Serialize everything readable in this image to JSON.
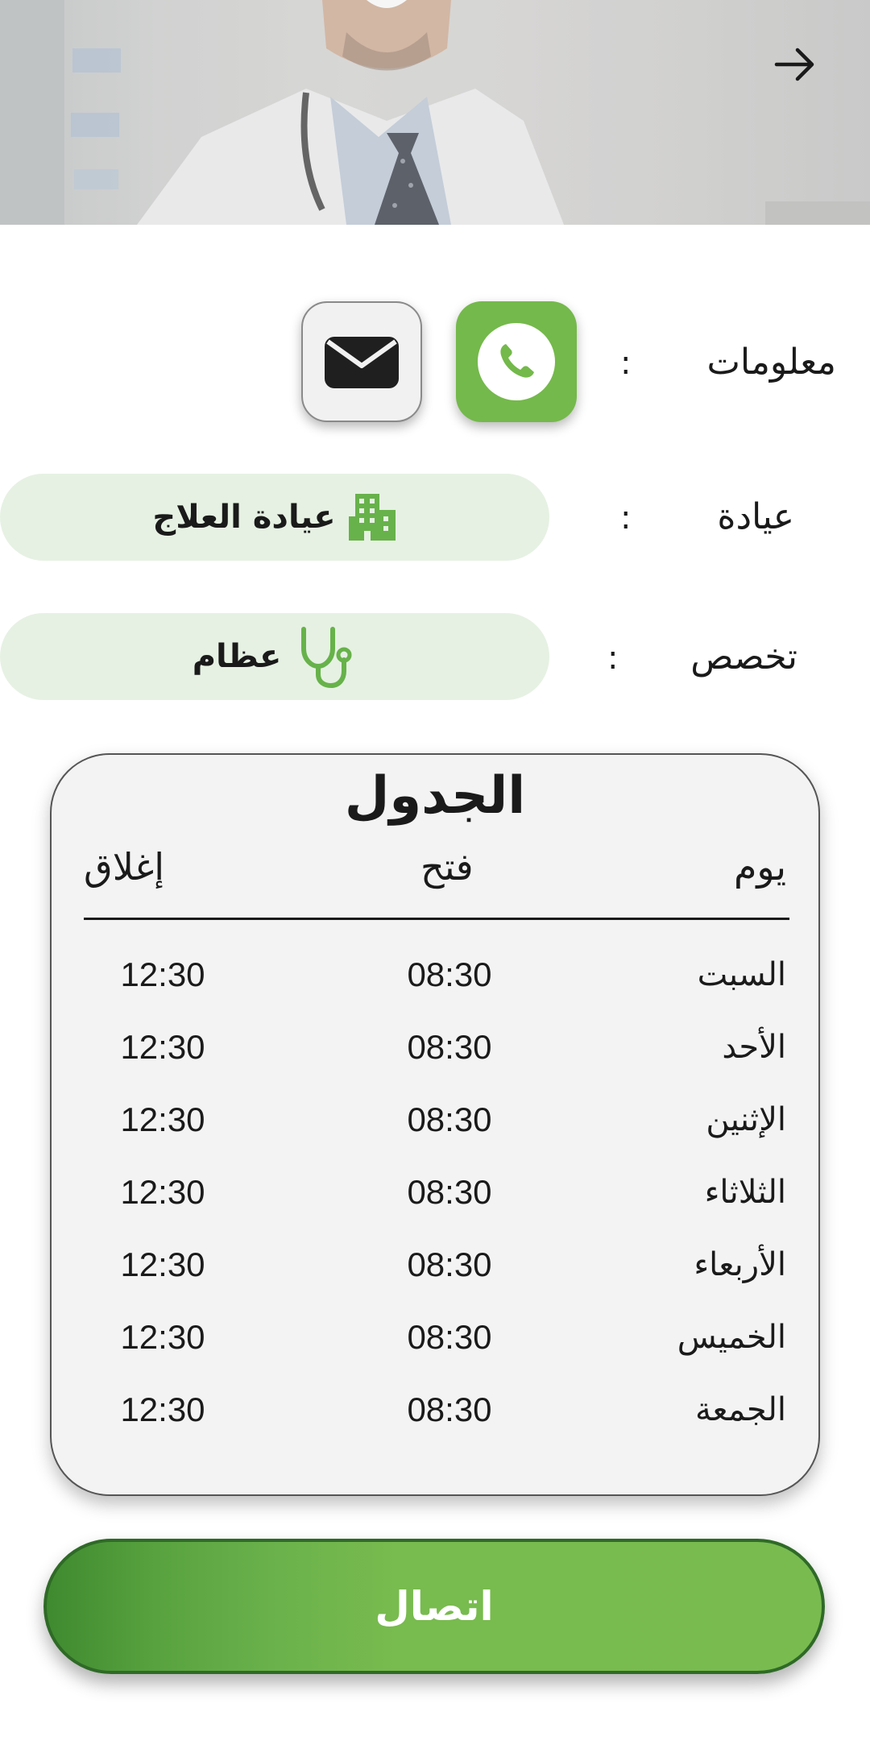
{
  "header": {
    "back_icon": "arrow-right-icon"
  },
  "info": {
    "label": "معلومات",
    "colon": ":",
    "phone_icon": "phone-icon",
    "email_icon": "mail-icon"
  },
  "clinic": {
    "label": "عيادة",
    "colon": ":",
    "value": "عيادة العلاج",
    "icon": "building-icon"
  },
  "specialty": {
    "label": "تخصص",
    "colon": ":",
    "value": "عظام",
    "icon": "stethoscope-icon"
  },
  "schedule": {
    "title": "الجدول",
    "headers": {
      "day": "يوم",
      "open": "فتح",
      "close": "إغلاق"
    },
    "rows": [
      {
        "day": "السبت",
        "open": "08:30",
        "close": "12:30"
      },
      {
        "day": "الأحد",
        "open": "08:30",
        "close": "12:30"
      },
      {
        "day": "الإثنين",
        "open": "08:30",
        "close": "12:30"
      },
      {
        "day": "الثلاثاء",
        "open": "08:30",
        "close": "12:30"
      },
      {
        "day": "الأربعاء",
        "open": "08:30",
        "close": "12:30"
      },
      {
        "day": "الخميس",
        "open": "08:30",
        "close": "12:30"
      },
      {
        "day": "الجمعة",
        "open": "08:30",
        "close": "12:30"
      }
    ]
  },
  "contact_button": {
    "label": "اتصال"
  },
  "colors": {
    "accent_green": "#78bb4e",
    "dark_green": "#2f6a27",
    "pill_bg": "#e6f1e3",
    "card_bg": "#f3f3f3"
  }
}
